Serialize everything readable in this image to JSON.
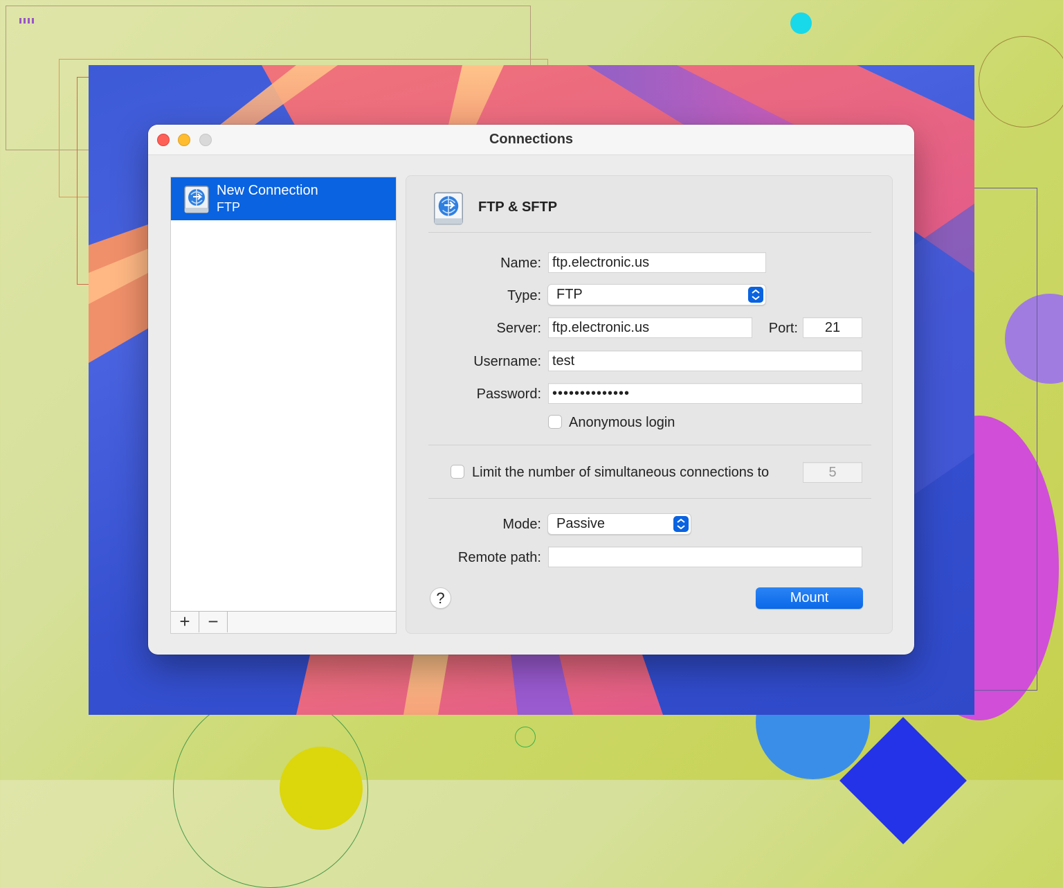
{
  "window": {
    "title": "Connections"
  },
  "sidebar": {
    "items": [
      {
        "title": "New Connection",
        "subtitle": "FTP"
      }
    ],
    "add_label": "+",
    "remove_label": "−"
  },
  "panel": {
    "title": "FTP & SFTP",
    "name": {
      "label": "Name:",
      "value": "ftp.electronic.us"
    },
    "type": {
      "label": "Type:",
      "value": "FTP"
    },
    "server": {
      "label": "Server:",
      "value": "ftp.electronic.us"
    },
    "port": {
      "label": "Port:",
      "value": "21"
    },
    "username": {
      "label": "Username:",
      "value": "test"
    },
    "password": {
      "label": "Password:",
      "value": "••••••••••••••"
    },
    "anonymous": {
      "label": "Anonymous login",
      "checked": false
    },
    "limit": {
      "label": "Limit the number of simultaneous connections to",
      "value": "5",
      "checked": false
    },
    "mode": {
      "label": "Mode:",
      "value": "Passive"
    },
    "remote_path": {
      "label": "Remote path:",
      "value": ""
    },
    "help_label": "?",
    "mount_label": "Mount"
  },
  "colors": {
    "accent": "#0a63e0",
    "close": "#fe5f57",
    "minimize": "#febc2e",
    "zoom": "#d9d9d9"
  }
}
